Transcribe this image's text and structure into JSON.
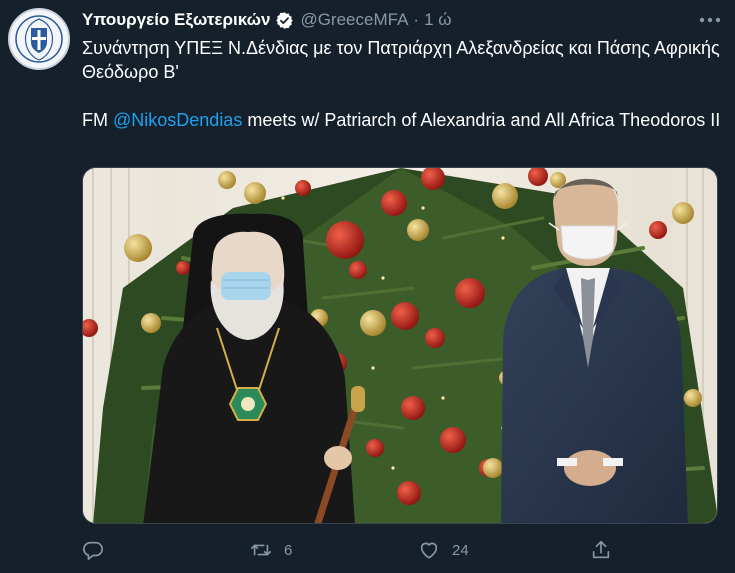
{
  "tweet": {
    "display_name": "Υπουργείο Εξωτερικών",
    "handle": "@GreeceMFA",
    "separator": "·",
    "time": "1 ώ",
    "text_greek": "Συνάντηση ΥΠΕΞ Ν.Δένδιας με τον Πατριάρχη Αλεξανδρείας και Πάσης Αφρικής Θεόδωρο Β'",
    "text_en_prefix": "FM ",
    "mention": "@NikosDendias",
    "text_en_suffix": " meets w/ Patriarch of Alexandria and All Africa Theodoros II"
  },
  "actions": {
    "reply_count": "",
    "retweet_count": "6",
    "like_count": "24"
  },
  "colors": {
    "background": "#15202b",
    "secondary_text": "#8899a6",
    "link": "#1da1f2"
  },
  "icons": [
    "greek-coat-of-arms-icon",
    "verified-badge-icon",
    "more-options-icon",
    "reply-icon",
    "retweet-icon",
    "like-icon",
    "share-icon"
  ]
}
